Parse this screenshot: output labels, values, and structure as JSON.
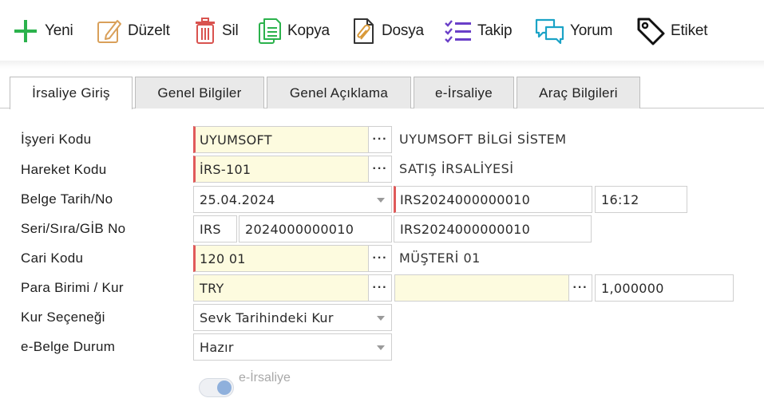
{
  "toolbar": {
    "new_label": "Yeni",
    "edit_label": "Düzelt",
    "delete_label": "Sil",
    "copy_label": "Kopya",
    "file_label": "Dosya",
    "track_label": "Takip",
    "comment_label": "Yorum",
    "tag_label": "Etiket"
  },
  "tabs": [
    {
      "label": "İrsaliye Giriş",
      "active": true
    },
    {
      "label": "Genel Bilgiler"
    },
    {
      "label": "Genel Açıklama"
    },
    {
      "label": "e-İrsaliye"
    },
    {
      "label": "Araç Bilgileri"
    }
  ],
  "form": {
    "isyeri": {
      "label": "İşyeri Kodu",
      "value": "UYUMSOFT",
      "desc": "UYUMSOFT BİLGİ SİSTEM"
    },
    "hareket": {
      "label": "Hareket Kodu",
      "value": "İRS-101",
      "desc": "SATIŞ İRSALİYESİ"
    },
    "belge": {
      "label": "Belge Tarih/No",
      "date": "25.04.2024",
      "no": "IRS2024000000010",
      "time": "16:12"
    },
    "seri": {
      "label": "Seri/Sıra/GİB No",
      "seri": "IRS",
      "sira": "2024000000010",
      "gib": "IRS2024000000010"
    },
    "cari": {
      "label": "Cari Kodu",
      "value": "120 01",
      "desc": "MÜŞTERİ 01"
    },
    "para": {
      "label": "Para Birimi / Kur",
      "currency": "TRY",
      "rate_type": "",
      "rate": "1,000000"
    },
    "kur_secenegi": {
      "label": "Kur Seçeneği",
      "value": "Sevk Tarihindeki Kur"
    },
    "ebelge": {
      "label": "e-Belge Durum",
      "value": "Hazır"
    },
    "toggle": {
      "label": "e-İrsaliye",
      "on": true
    }
  },
  "ellipsis": "···",
  "colors": {
    "required_marker": "#e05a5a",
    "required_bg": "#fdfbdf",
    "add_green": "#2bb24c",
    "delete_red": "#d9534f",
    "track_purple": "#6a3fc8",
    "comment_teal": "#1ba3c6"
  }
}
